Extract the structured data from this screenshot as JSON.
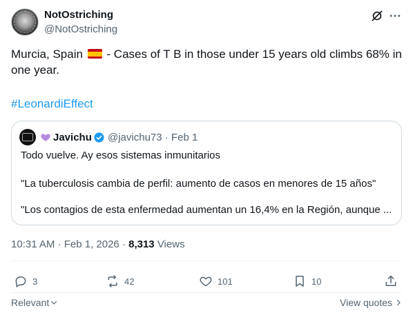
{
  "author": {
    "display_name": "NotOstriching",
    "handle": "@NotOstriching"
  },
  "post": {
    "text_before_flag": "Murcia, Spain",
    "text_after_flag": "- Cases of T B in those under 15 years old climbs 68% in one year.",
    "hashtag": "#LeonardiEffect",
    "timestamp": "10:31 AM · Feb 1, 2026 ·",
    "views_count": "8,313",
    "views_label": "Views"
  },
  "quoted": {
    "display_name": "Javichu",
    "handle_date": "@javichu73 · Feb 1",
    "line1": "Todo vuelve. Ay esos sistemas inmunitarios",
    "line2": "\"La tuberculosis cambia de perfil: aumento de casos en menores de 15 años\"",
    "line3": "\"Los contagios de esta enfermedad aumentan un 16,4% en la Región, aunque ..."
  },
  "actions": {
    "replies": "3",
    "reposts": "42",
    "likes": "101",
    "bookmarks": "10"
  },
  "footer": {
    "sort_label": "Relevant",
    "view_quotes_label": "View quotes"
  },
  "colors": {
    "accent": "#1d9bf0",
    "secondary_text": "#536471",
    "border": "#cfd9de",
    "verified": "#1d9bf0",
    "purple_heart": "#b58ae0"
  }
}
